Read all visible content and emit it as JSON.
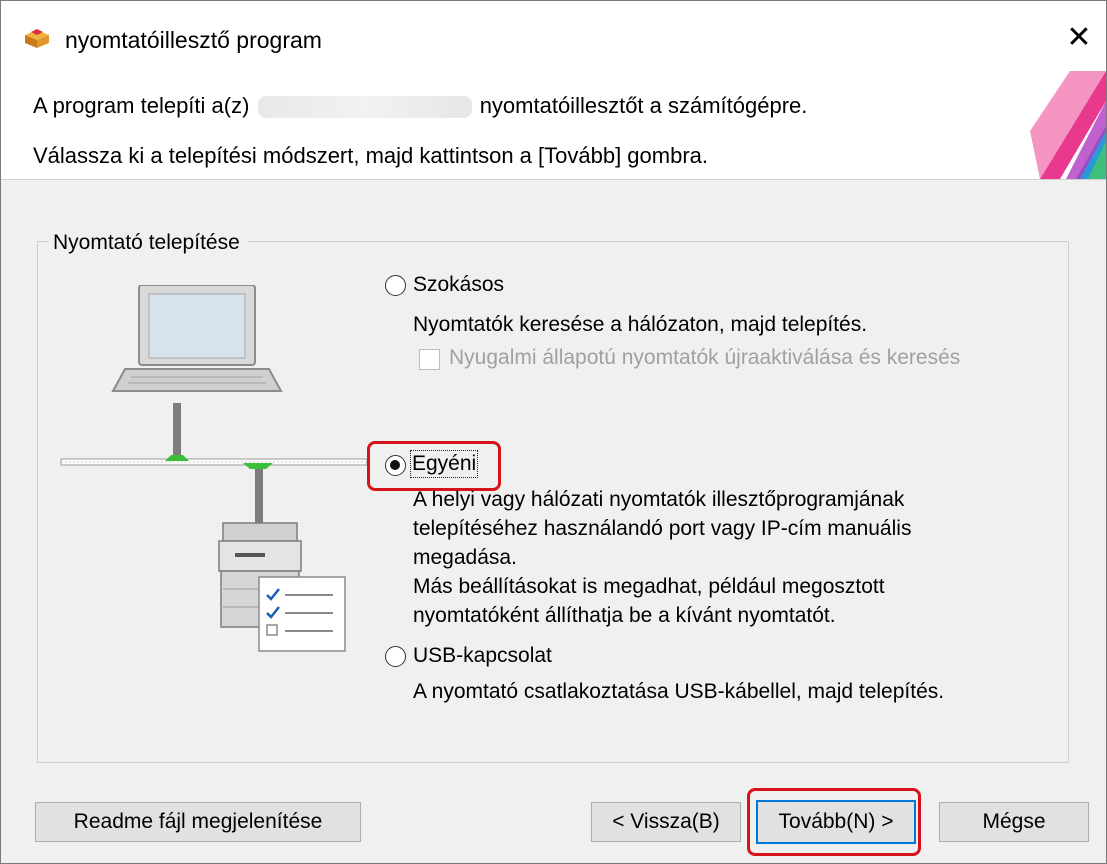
{
  "window": {
    "title": "nyomtatóillesztő program"
  },
  "intro": {
    "line1_prefix": "A program telepíti a(z)",
    "line1_suffix": "nyomtatóillesztőt a számítógépre.",
    "line2": "Válassza ki a telepítési módszert, majd kattintson a [Tovább] gombra."
  },
  "group": {
    "legend": "Nyomtató telepítése",
    "options": [
      {
        "label": "Szokásos",
        "selected": false,
        "description": [
          "Nyomtatók keresése a hálózaton, majd telepítés."
        ]
      },
      {
        "label": "Egyéni",
        "selected": true,
        "description": [
          "A helyi vagy hálózati nyomtatók illesztőprogramjának",
          "telepítéséhez használandó port vagy IP-cím manuális",
          "megadása.",
          "Más beállításokat is megadhat, például megosztott",
          "nyomtatóként állíthatja be a kívánt nyomtatót."
        ]
      },
      {
        "label": "USB-kapcsolat",
        "selected": false,
        "description": [
          "A nyomtató csatlakoztatása USB-kábellel, majd telepítés."
        ]
      }
    ],
    "sleep_checkbox": {
      "label": "Nyugalmi állapotú nyomtatók újraaktiválása és keresés",
      "checked": false,
      "enabled": false
    }
  },
  "buttons": {
    "readme": "Readme fájl megjelenítése",
    "back": "< Vissza(B)",
    "next": "Tovább(N) >",
    "cancel": "Mégse"
  },
  "colors": {
    "highlight": "#d6121a",
    "default_button_border": "#0078d7",
    "network_connector": "#3bbf3b"
  }
}
